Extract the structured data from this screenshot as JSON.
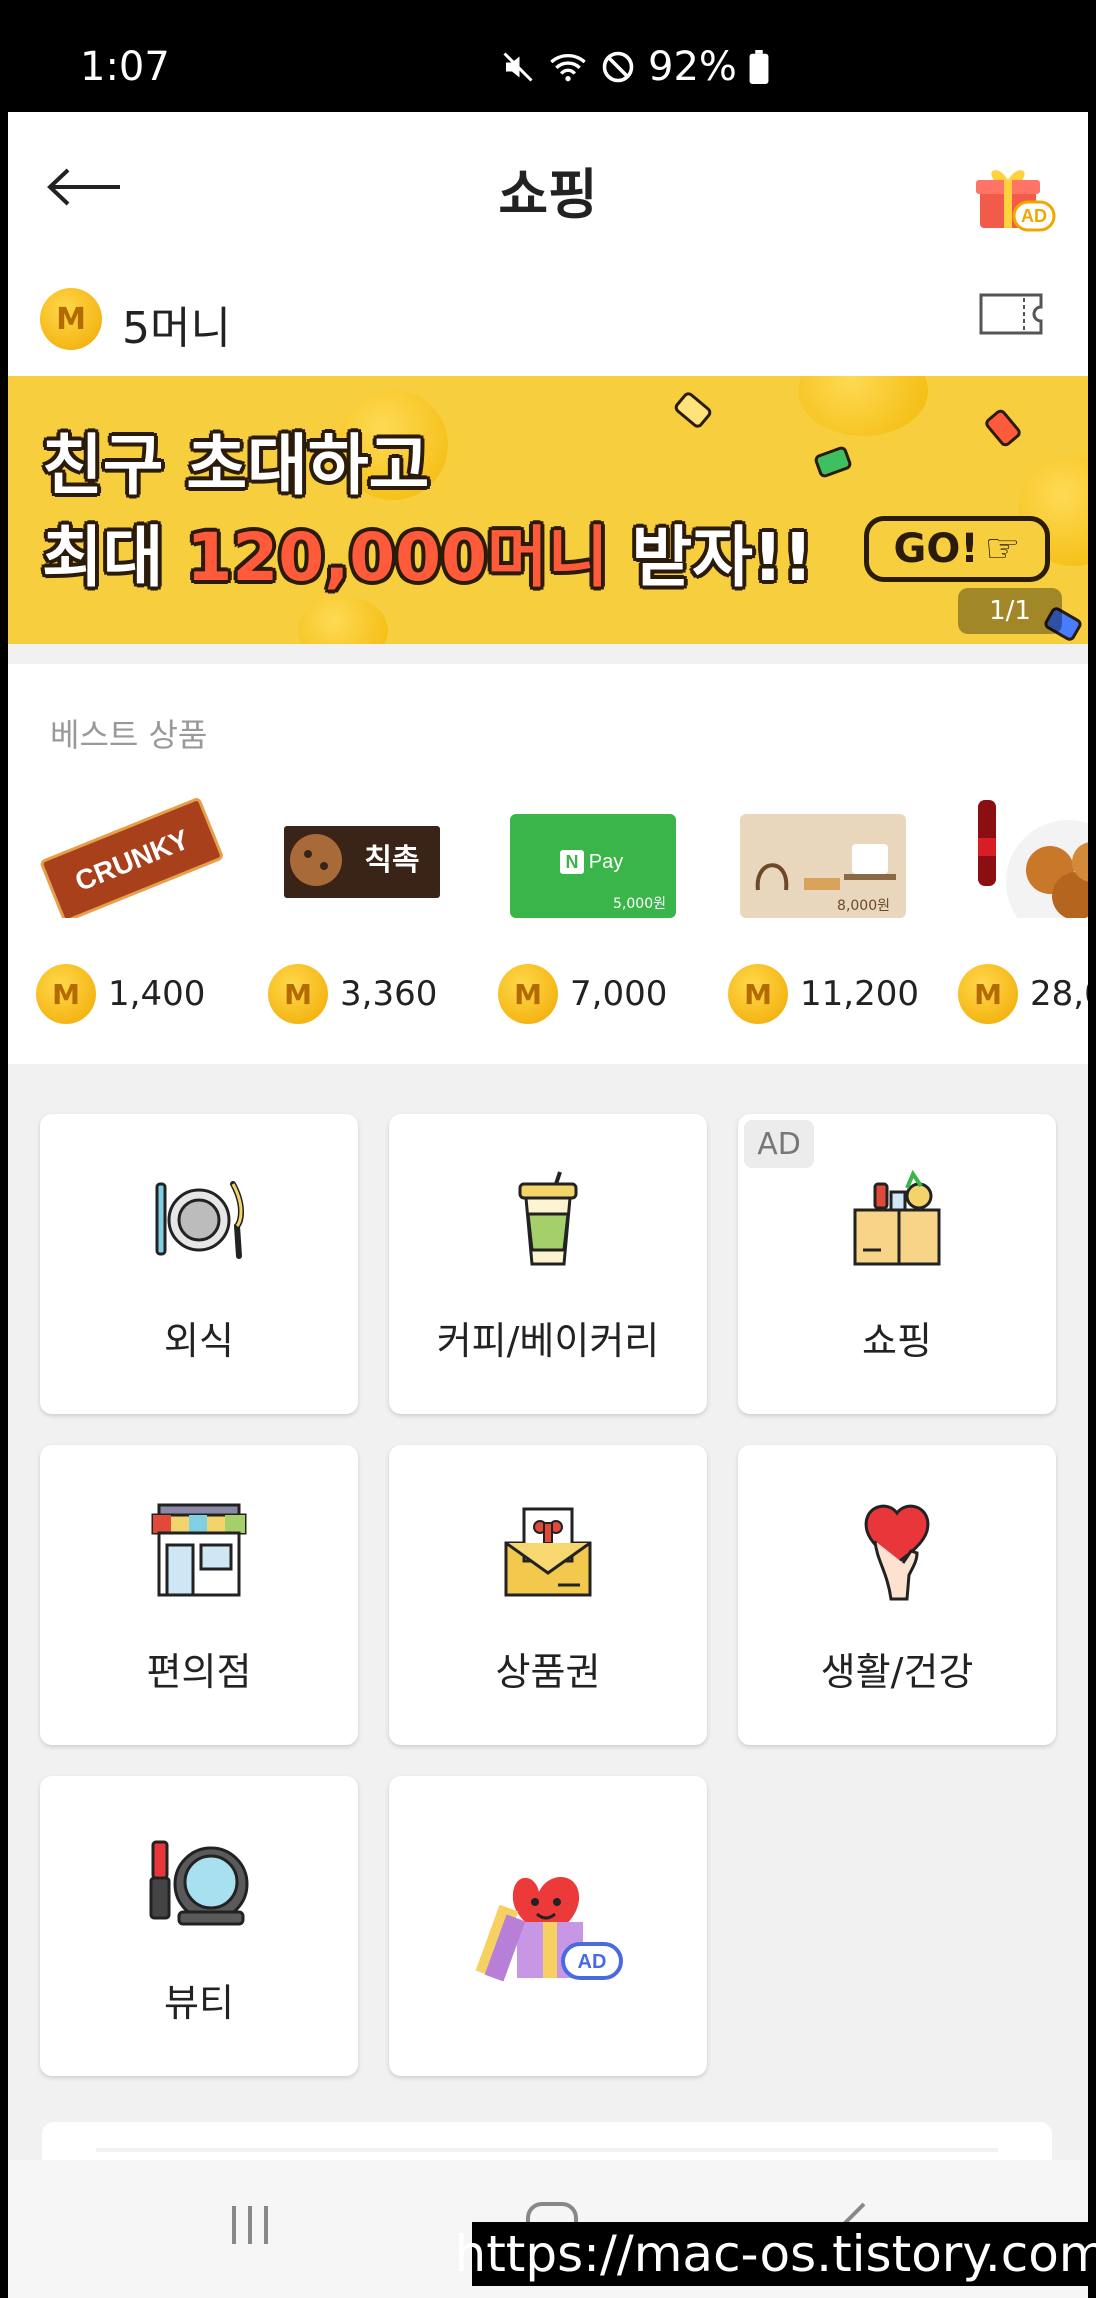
{
  "status_bar": {
    "time": "1:07",
    "battery": "92%"
  },
  "header": {
    "title": "쇼핑",
    "gift_ad_label": "AD"
  },
  "money": {
    "coin_symbol": "M",
    "amount": "5머니"
  },
  "banner": {
    "line1": "친구 초대하고",
    "line2_prefix": "최대 ",
    "line2_highlight": "120,000머니",
    "line2_suffix": " 받자!!",
    "go_label": "GO!",
    "counter": "1/1",
    "colors": {
      "background": "#f7cf3e",
      "highlight": "#ff5b3b"
    }
  },
  "best": {
    "title": "베스트 상품",
    "products": [
      {
        "name": "crunky-chocolate",
        "price": "1,400"
      },
      {
        "name": "chick-chock-cookies",
        "price": "3,360",
        "label": "칙촉"
      },
      {
        "name": "naver-pay-giftcard",
        "price": "7,000",
        "label": "N Pay",
        "value": "5,000원"
      },
      {
        "name": "bakery-giftcard",
        "price": "11,200",
        "value": "8,000원"
      },
      {
        "name": "chicken-cola-set",
        "price": "28,0"
      }
    ]
  },
  "categories": [
    {
      "label": "외식",
      "icon": "plate-cutlery-icon",
      "ad": ""
    },
    {
      "label": "커피/베이커리",
      "icon": "coffee-cup-icon",
      "ad": ""
    },
    {
      "label": "쇼핑",
      "icon": "shopping-box-icon",
      "ad": "AD"
    },
    {
      "label": "편의점",
      "icon": "store-icon",
      "ad": ""
    },
    {
      "label": "상품권",
      "icon": "gift-voucher-icon",
      "ad": ""
    },
    {
      "label": "생활/건강",
      "icon": "heart-hand-icon",
      "ad": ""
    },
    {
      "label": "뷰티",
      "icon": "compact-mirror-icon",
      "ad": ""
    },
    {
      "label": "",
      "icon": "heart-gift-ad-icon",
      "ad": "AD"
    }
  ],
  "watermark": "https://mac-os.tistory.com"
}
